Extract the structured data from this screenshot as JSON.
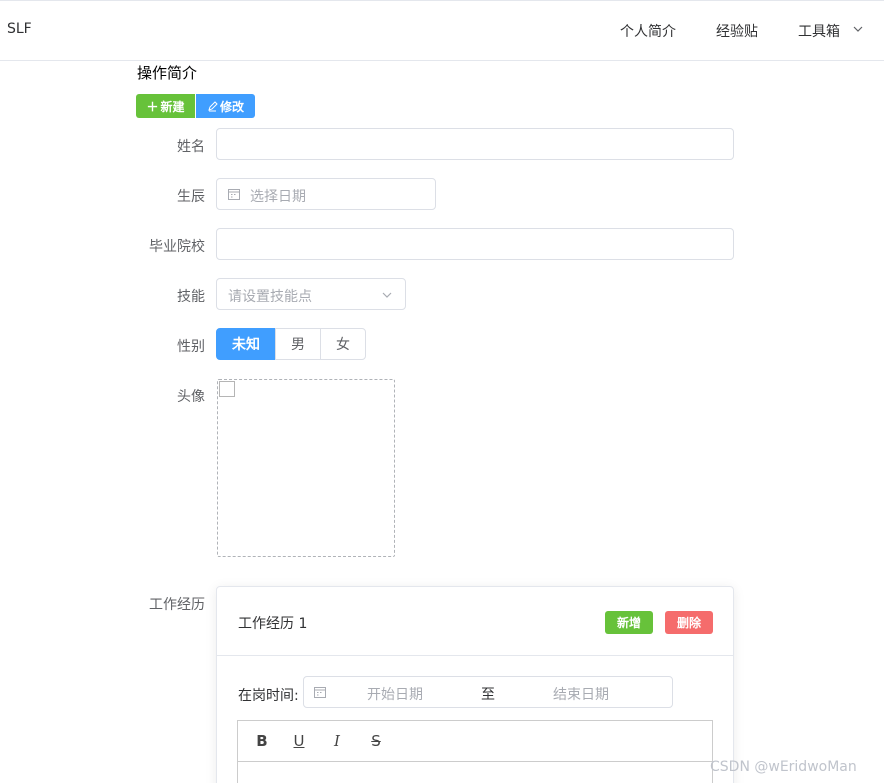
{
  "header": {
    "brand": "SLF",
    "nav": [
      {
        "label": "个人简介"
      },
      {
        "label": "经验贴"
      },
      {
        "label": "工具箱"
      }
    ]
  },
  "section": {
    "title": "操作简介",
    "new_button": "新建",
    "edit_button": "修改"
  },
  "form": {
    "name_label": "姓名",
    "name_value": "",
    "birth_label": "生辰",
    "birth_placeholder": "选择日期",
    "school_label": "毕业院校",
    "school_value": "",
    "skill_label": "技能",
    "skill_placeholder": "请设置技能点",
    "gender_label": "性别",
    "gender_options": [
      "未知",
      "男",
      "女"
    ],
    "gender_selected": "未知",
    "avatar_label": "头像",
    "work_label": "工作经历"
  },
  "work_card": {
    "title": "工作经历 1",
    "add_button": "新增",
    "delete_button": "删除",
    "period_label": "在岗时间:",
    "start_placeholder": "开始日期",
    "range_separator": "至",
    "end_placeholder": "结束日期",
    "toolbar": [
      "B",
      "U",
      "I",
      "S"
    ]
  },
  "watermark": "CSDN @\u0001wEridwoMan",
  "colors": {
    "primary": "#409eff",
    "success": "#67c23a",
    "danger": "#f56c6c"
  }
}
